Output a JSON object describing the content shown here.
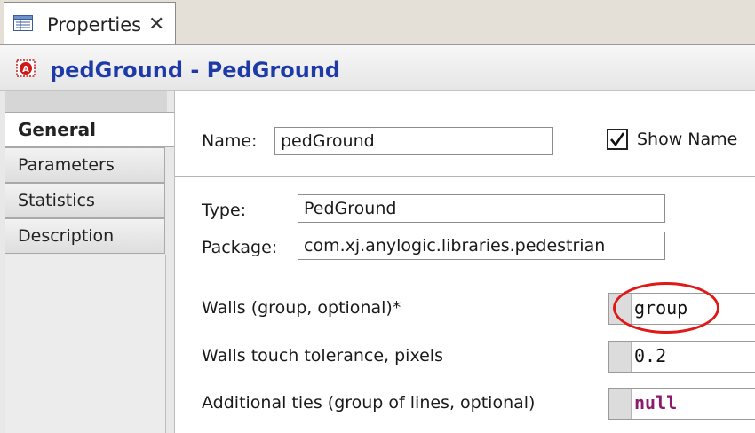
{
  "tab": {
    "label": "Properties"
  },
  "title": {
    "text": "pedGround - PedGround"
  },
  "sections": [
    {
      "label": "General"
    },
    {
      "label": "Parameters"
    },
    {
      "label": "Statistics"
    },
    {
      "label": "Description"
    }
  ],
  "general": {
    "name_label": "Name:",
    "name_value": "pedGround",
    "show_name_label": "Show Name",
    "show_name_checked": true,
    "type_label": "Type:",
    "type_value": "PedGround",
    "package_label": "Package:",
    "package_value": "com.xj.anylogic.libraries.pedestrian"
  },
  "parameters": [
    {
      "label": "Walls (group, optional)*",
      "value": "group"
    },
    {
      "label": "Walls touch tolerance, pixels",
      "value": "0.2"
    },
    {
      "label": "Additional ties (group of lines, optional)",
      "value": "null"
    }
  ],
  "colors": {
    "title": "#1e3aa8",
    "keyword": "#8b1a6b",
    "highlight": "#e01818"
  }
}
